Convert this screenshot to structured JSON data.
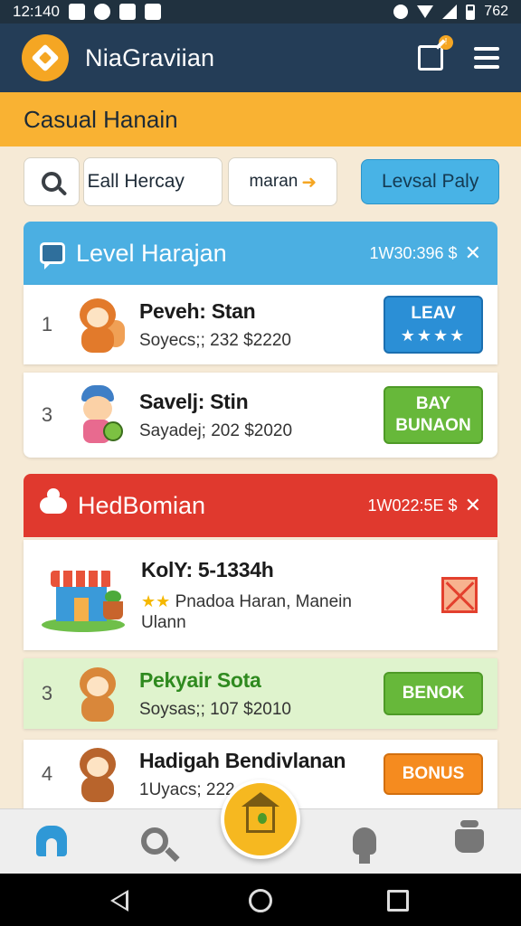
{
  "status_bar": {
    "time": "12:140",
    "battery": "762"
  },
  "app": {
    "title": "NiaGraviian"
  },
  "banner": {
    "title": "Casual Hanain"
  },
  "search": {
    "value": "Eall Hercay",
    "secondary": "maran",
    "button_label": "Levsal Paly"
  },
  "sections": [
    {
      "title": "Level Harajan",
      "meta": "1W30:396 $",
      "rows": [
        {
          "rank": "1",
          "name": "Peveh: Stan",
          "sub": "Soyecs;; 232 $2220",
          "button_line1": "LEAV",
          "button_line2": "★★★★"
        },
        {
          "rank": "3",
          "name": "Savelj: Stin",
          "sub": "Sayadej; 202 $2020",
          "button_line1": "BAY",
          "button_line2": "BUNAON"
        }
      ]
    },
    {
      "title": "HedBomian",
      "meta": "1W022:5E $",
      "featured": {
        "name": "KolY: 5-1334h",
        "line1": "Pnadoa Haran, Manein",
        "line2": "Ulann"
      },
      "rows": [
        {
          "rank": "3",
          "name": "Pekyair Sota",
          "sub": "Soysas;; 107 $2010",
          "button_label": "BENOK"
        },
        {
          "rank": "4",
          "name": "Hadigah Bendivlanan",
          "sub": "1Uyacs; 222",
          "button_label": "BONUS"
        }
      ]
    }
  ],
  "colors": {
    "appbar": "#243d57",
    "banner": "#f9b233",
    "section1": "#4bafe2",
    "section2": "#e0392e",
    "fab": "#f6b820"
  }
}
